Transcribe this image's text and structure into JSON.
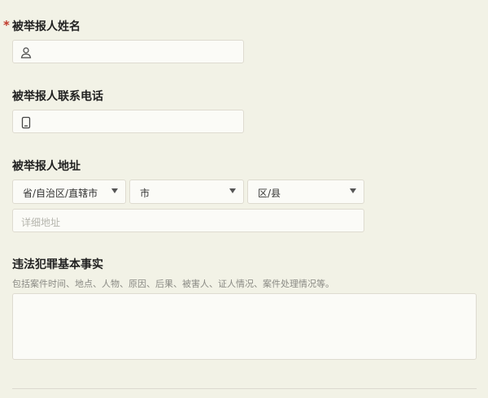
{
  "fields": {
    "name": {
      "required_mark": "*",
      "label": "被举报人姓名",
      "icon": "person-icon",
      "value": ""
    },
    "phone": {
      "label": "被举报人联系电话",
      "icon": "phone-icon",
      "value": ""
    },
    "address": {
      "label": "被举报人地址",
      "province_select": "省/自治区/直辖市",
      "city_select": "市",
      "district_select": "区/县",
      "detail_placeholder": "详细地址",
      "detail_value": ""
    },
    "facts": {
      "label": "违法犯罪基本事实",
      "hint": "包括案件时间、地点、人物、原因、后果、被害人、证人情况、案件处理情况等。",
      "value": ""
    }
  },
  "colors": {
    "background": "#f2f2e6",
    "input_background": "#fbfbf7",
    "input_border": "#dedbd0",
    "required": "#c0392b"
  }
}
